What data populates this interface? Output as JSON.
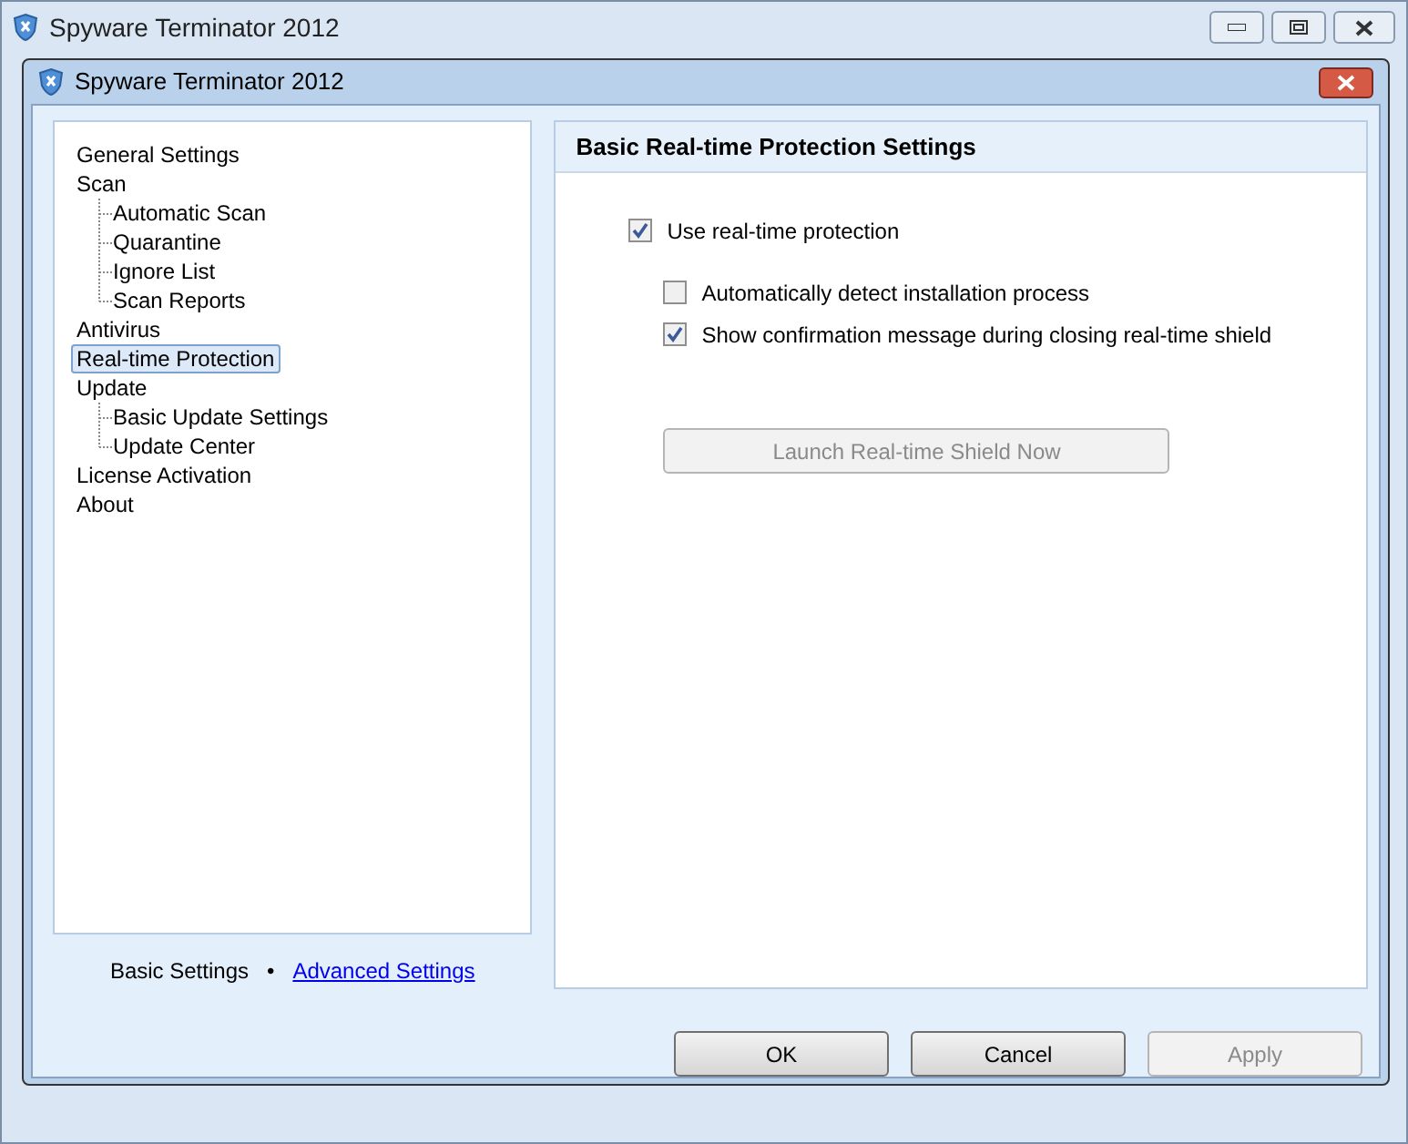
{
  "window": {
    "title": "Spyware Terminator 2012"
  },
  "dialog": {
    "title": "Spyware Terminator 2012"
  },
  "sidebar": {
    "items": [
      {
        "label": "General Settings",
        "selected": false
      },
      {
        "label": "Scan",
        "selected": false,
        "children": [
          {
            "label": "Automatic Scan",
            "selected": false
          },
          {
            "label": "Quarantine",
            "selected": false
          },
          {
            "label": "Ignore List",
            "selected": false
          },
          {
            "label": "Scan Reports",
            "selected": false
          }
        ]
      },
      {
        "label": "Antivirus",
        "selected": false
      },
      {
        "label": "Real-time Protection",
        "selected": true
      },
      {
        "label": "Update",
        "selected": false,
        "children": [
          {
            "label": "Basic Update Settings",
            "selected": false
          },
          {
            "label": "Update Center",
            "selected": false
          }
        ]
      },
      {
        "label": "License Activation",
        "selected": false
      },
      {
        "label": "About",
        "selected": false
      }
    ]
  },
  "mode_switch": {
    "current": "Basic Settings",
    "separator": "•",
    "link": "Advanced Settings"
  },
  "panel": {
    "title": "Basic Real-time Protection Settings",
    "options": [
      {
        "label": "Use real-time protection",
        "checked": true,
        "children": [
          {
            "label": "Automatically detect installation process",
            "checked": false
          },
          {
            "label": "Show confirmation message during closing real-time shield",
            "checked": true
          }
        ]
      }
    ],
    "action_button": {
      "label": "Launch Real-time Shield Now",
      "disabled": true
    }
  },
  "buttons": [
    {
      "label": "OK",
      "disabled": false
    },
    {
      "label": "Cancel",
      "disabled": false
    },
    {
      "label": "Apply",
      "disabled": true
    }
  ]
}
